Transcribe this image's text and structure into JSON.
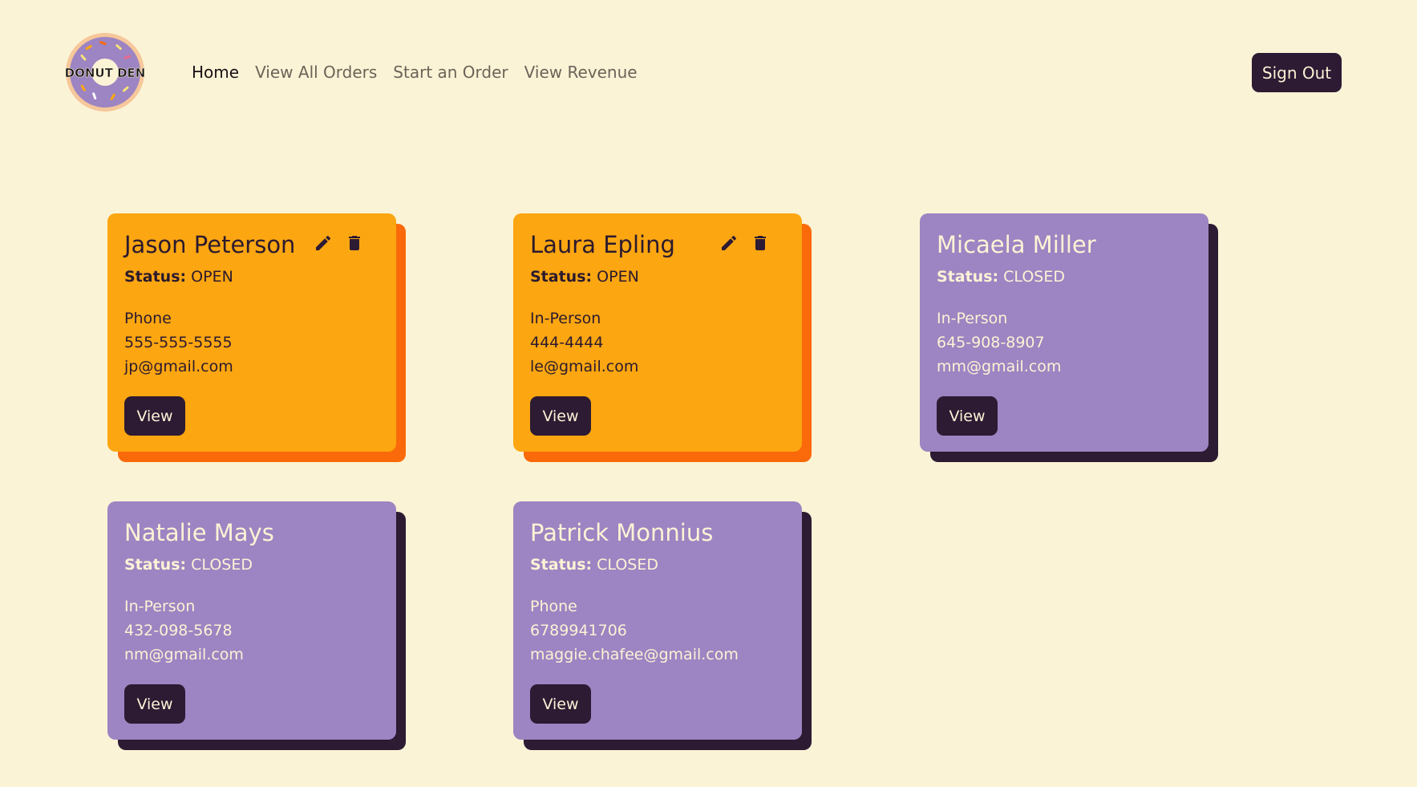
{
  "brand": {
    "logo_text": "DONUT DEN"
  },
  "nav": {
    "links": [
      {
        "label": "Home",
        "active": true
      },
      {
        "label": "View All Orders",
        "active": false
      },
      {
        "label": "Start an Order",
        "active": false
      },
      {
        "label": "View Revenue",
        "active": false
      }
    ],
    "sign_out_label": "Sign Out"
  },
  "colors": {
    "background": "#fbf3d6",
    "open_card": "#fca611",
    "open_shadow": "#fa6a0a",
    "closed_card": "#9d84c2",
    "dark": "#2d1a33"
  },
  "orders": [
    {
      "name": "Jason Peterson",
      "status_label": "Status:",
      "status": "OPEN",
      "type": "Phone",
      "phone": "555-555-5555",
      "email": "jp@gmail.com",
      "view_label": "View",
      "edit_icon": "pencil-icon",
      "delete_icon": "trash-icon"
    },
    {
      "name": "Laura Epling",
      "status_label": "Status:",
      "status": "OPEN",
      "type": "In-Person",
      "phone": "444-4444",
      "email": "le@gmail.com",
      "view_label": "View",
      "edit_icon": "pencil-icon",
      "delete_icon": "trash-icon"
    },
    {
      "name": "Micaela Miller",
      "status_label": "Status:",
      "status": "CLOSED",
      "type": "In-Person",
      "phone": "645-908-8907",
      "email": "mm@gmail.com",
      "view_label": "View"
    },
    {
      "name": "Natalie Mays",
      "status_label": "Status:",
      "status": "CLOSED",
      "type": "In-Person",
      "phone": "432-098-5678",
      "email": "nm@gmail.com",
      "view_label": "View"
    },
    {
      "name": "Patrick Monnius",
      "status_label": "Status:",
      "status": "CLOSED",
      "type": "Phone",
      "phone": "6789941706",
      "email": "maggie.chafee@gmail.com",
      "view_label": "View"
    }
  ]
}
